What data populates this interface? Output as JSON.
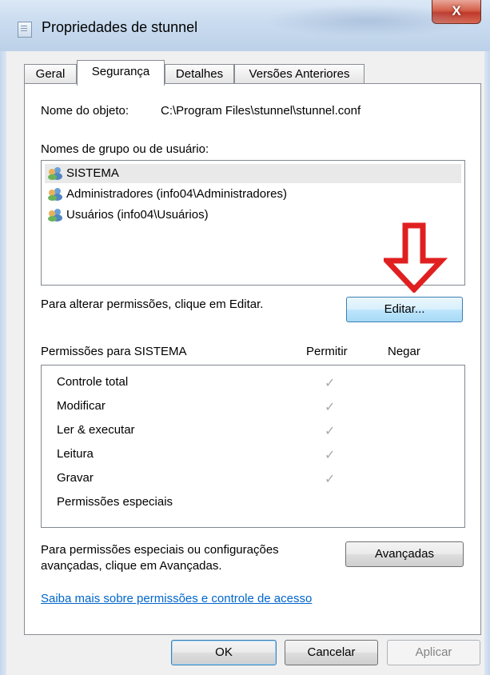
{
  "window": {
    "title": "Propriedades de stunnel",
    "close_glyph": "X"
  },
  "tabs": [
    {
      "label": "Geral",
      "active": false
    },
    {
      "label": "Segurança",
      "active": true
    },
    {
      "label": "Detalhes",
      "active": false
    },
    {
      "label": "Versões Anteriores",
      "active": false
    }
  ],
  "object": {
    "label": "Nome do objeto:",
    "value": "C:\\Program Files\\stunnel\\stunnel.conf"
  },
  "groups": {
    "label": "Nomes de grupo ou de usuário:",
    "items": [
      {
        "name": "SISTEMA",
        "icon": "users-icon",
        "selected": true
      },
      {
        "name": "Administradores (info04\\Administradores)",
        "icon": "users-icon",
        "selected": false
      },
      {
        "name": "Usuários (info04\\Usuários)",
        "icon": "users-icon",
        "selected": false
      }
    ]
  },
  "edit": {
    "hint": "Para alterar permissões, clique em Editar.",
    "button_label": "Editar..."
  },
  "permissions": {
    "header": "Permissões para SISTEMA",
    "allow_header": "Permitir",
    "deny_header": "Negar",
    "rows": [
      {
        "name": "Controle total",
        "allow": true,
        "deny": false
      },
      {
        "name": "Modificar",
        "allow": true,
        "deny": false
      },
      {
        "name": "Ler & executar",
        "allow": true,
        "deny": false
      },
      {
        "name": "Leitura",
        "allow": true,
        "deny": false
      },
      {
        "name": "Gravar",
        "allow": true,
        "deny": false
      },
      {
        "name": "Permissões especiais",
        "allow": false,
        "deny": false
      }
    ],
    "check_glyph": "✓"
  },
  "advanced": {
    "hint_line1": "Para permissões especiais ou configurações",
    "hint_line2": "avançadas, clique em Avançadas.",
    "button_label": "Avançadas"
  },
  "help_link": "Saiba mais sobre permissões e controle de acesso",
  "footer": {
    "ok": "OK",
    "cancel": "Cancelar",
    "apply": "Aplicar"
  },
  "colors": {
    "arrow": "#e02020",
    "link": "#0066cc"
  }
}
